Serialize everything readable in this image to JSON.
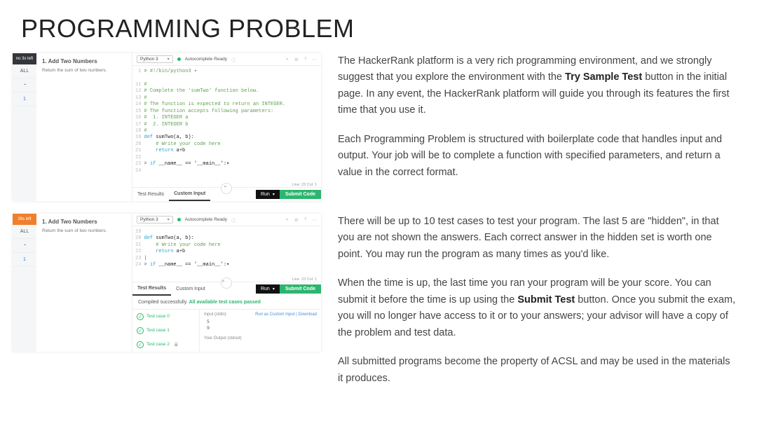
{
  "pageTitle": "PROGRAMMING PROBLEM",
  "paragraphs": {
    "p1a": "The HackerRank platform is a very rich programming environment, and we strongly suggest that you explore the environment with the ",
    "p1b": "Try Sample Test",
    "p1c": " button in the initial page. In any event, the HackerRank platform will guide you through its features the first time that you use it.",
    "p2": "Each Programming Problem is structured with boilerplate code that handles input and output. Your job will be to complete a function with specified parameters, and return a value in the correct format.",
    "p3": "There will be up to 10 test cases to test your program. The last 5 are \"hidden\", in that you are not shown the answers. Each correct answer in the hidden set is worth one point. You may run the program as many times as you'd like.",
    "p4a": "When the time is up, the last time you ran your program will be your score.  You can submit it before the time is up using the ",
    "p4b": "Submit Test",
    "p4c": " button. Once you submit the exam, you will no longer have access to it or to your answers; your advisor will have a copy of the problem and test data.",
    "p5": "All submitted programs become the property of ACSL and may be used in the materials it produces."
  },
  "ss1": {
    "timerLabel": "no 3s left",
    "allLabel": "ALL",
    "clockIcon": "◔",
    "navItem": "1",
    "problemTitle": "1. Add Two Numbers",
    "problemPrompt": "Return the sum of two numbers.",
    "language": "Python 3",
    "autocomplete": "Autocomplete Ready",
    "icons": {
      "theme": "◐",
      "settings": "⚙",
      "help": "?",
      "more": "⋯"
    },
    "code": {
      "gutter": "1\n\n11\n12\n13\n14\n15\n16\n17\n18\n19\n20\n21\n22\n23\n24",
      "l1": "#!/bin/python3 ▾",
      "l2": "#",
      "l3": "# Complete the 'sumTwo' function below.",
      "l4": "#",
      "l5": "# The function is expected to return an INTEGER.",
      "l6": "# The function accepts following parameters:",
      "l7": "#  1. INTEGER a",
      "l8": "#  2. INTEGER b",
      "l9": "#",
      "l10a": "def ",
      "l10b": "sumTwo(a, b):",
      "l11": "    # Write your code here",
      "l12a": "    return ",
      "l12b": "a+b",
      "l13a": "if ",
      "l13b": "__name__ == '__main__':▾"
    },
    "timeBar": "Line: 23 Col: 1",
    "tabs": {
      "results": "Test Results",
      "custom": "Custom Input"
    },
    "runLabel": "Run",
    "submitLabel": "Submit Code",
    "caret": "⌃"
  },
  "ss2": {
    "timerLabel": "26s left",
    "compiled": {
      "prefix": "Compiled successfully. ",
      "result": "All available test cases passed"
    },
    "testCases": [
      {
        "label": "Test case 0",
        "locked": false
      },
      {
        "label": "Test case 1",
        "locked": false
      },
      {
        "label": "Test case 2",
        "locked": true
      }
    ],
    "io": {
      "inputLabel": "Input (stdin)",
      "actions": "Run as Custom Input | Download",
      "inputLines": [
        "5",
        "9"
      ],
      "outputLabel": "Your Output (stdout)"
    },
    "shortCode": {
      "gutter": "19\n20\n21\n22\n23\n24",
      "l20a": "def ",
      "l20b": "sumTwo(a, b):",
      "l21": "    # Write your code here",
      "l22a": "    return ",
      "l22b": "a+b",
      "cursor": "|",
      "l24a": "if ",
      "l24b": "__name__ == '__main__':▾"
    }
  }
}
